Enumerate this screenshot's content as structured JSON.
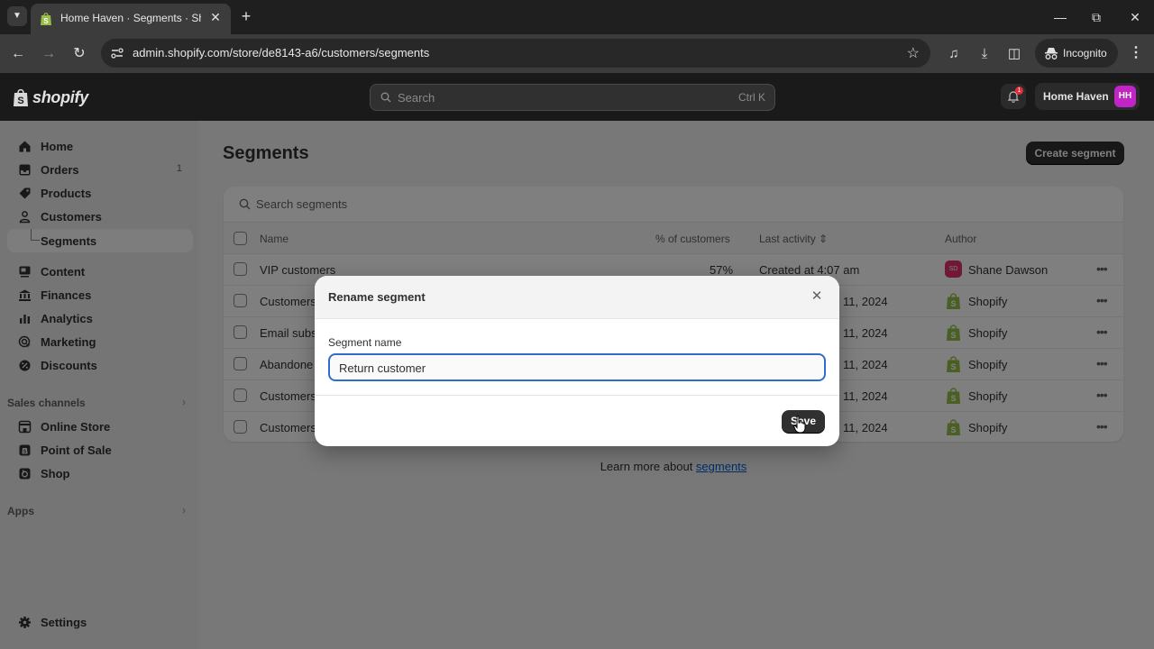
{
  "browser": {
    "tab_title": "Home Haven · Segments · Shopify",
    "url": "admin.shopify.com/store/de8143-a6/customers/segments",
    "incognito_label": "Incognito"
  },
  "topbar": {
    "logo_text": "shopify",
    "search_placeholder": "Search",
    "search_shortcut": "Ctrl K",
    "notification_count": "1",
    "store_name": "Home Haven",
    "store_initials": "HH"
  },
  "sidebar": {
    "items": [
      {
        "label": "Home",
        "icon": "home-icon"
      },
      {
        "label": "Orders",
        "icon": "orders-icon",
        "count": "1"
      },
      {
        "label": "Products",
        "icon": "tag-icon"
      },
      {
        "label": "Customers",
        "icon": "person-icon"
      },
      {
        "label": "Segments",
        "icon": "sub-item-connector"
      },
      {
        "label": "Content",
        "icon": "content-icon"
      },
      {
        "label": "Finances",
        "icon": "bank-icon"
      },
      {
        "label": "Analytics",
        "icon": "bar-chart-icon"
      },
      {
        "label": "Marketing",
        "icon": "target-icon"
      },
      {
        "label": "Discounts",
        "icon": "discount-icon"
      }
    ],
    "sales_channels_label": "Sales channels",
    "channels": [
      {
        "label": "Online Store",
        "icon": "store-icon"
      },
      {
        "label": "Point of Sale",
        "icon": "pos-icon"
      },
      {
        "label": "Shop",
        "icon": "shop-icon"
      }
    ],
    "apps_label": "Apps",
    "settings_label": "Settings"
  },
  "main": {
    "title": "Segments",
    "create_button": "Create segment",
    "search_placeholder": "Search segments",
    "columns": {
      "name": "Name",
      "percent": "% of customers",
      "last_activity": "Last activity",
      "author": "Author"
    },
    "rows": [
      {
        "name": "VIP customers",
        "percent": "57%",
        "last_activity": "Created at 4:07 am",
        "author": "Shane Dawson",
        "author_initials": "SD"
      },
      {
        "name": "Customers",
        "percent": "",
        "last_activity": "11, 2024",
        "author": "Shopify"
      },
      {
        "name": "Email subs",
        "percent": "",
        "last_activity": "11, 2024",
        "author": "Shopify"
      },
      {
        "name": "Abandone",
        "percent": "",
        "last_activity": "11, 2024",
        "author": "Shopify"
      },
      {
        "name": "Customers",
        "percent": "",
        "last_activity": "11, 2024",
        "author": "Shopify"
      },
      {
        "name": "Customers",
        "percent": "",
        "last_activity": "11, 2024",
        "author": "Shopify"
      }
    ],
    "learn_more_prefix": "Learn more about ",
    "learn_more_link": "segments"
  },
  "modal": {
    "title": "Rename segment",
    "field_label": "Segment name",
    "field_value": "Return customer",
    "save_button": "Save"
  },
  "colors": {
    "accent": "#2c6ecb",
    "primary_button": "#303030",
    "shopify_green": "#95bf47",
    "store_avatar": "#c225c6",
    "author_avatar": "#e0306a"
  }
}
